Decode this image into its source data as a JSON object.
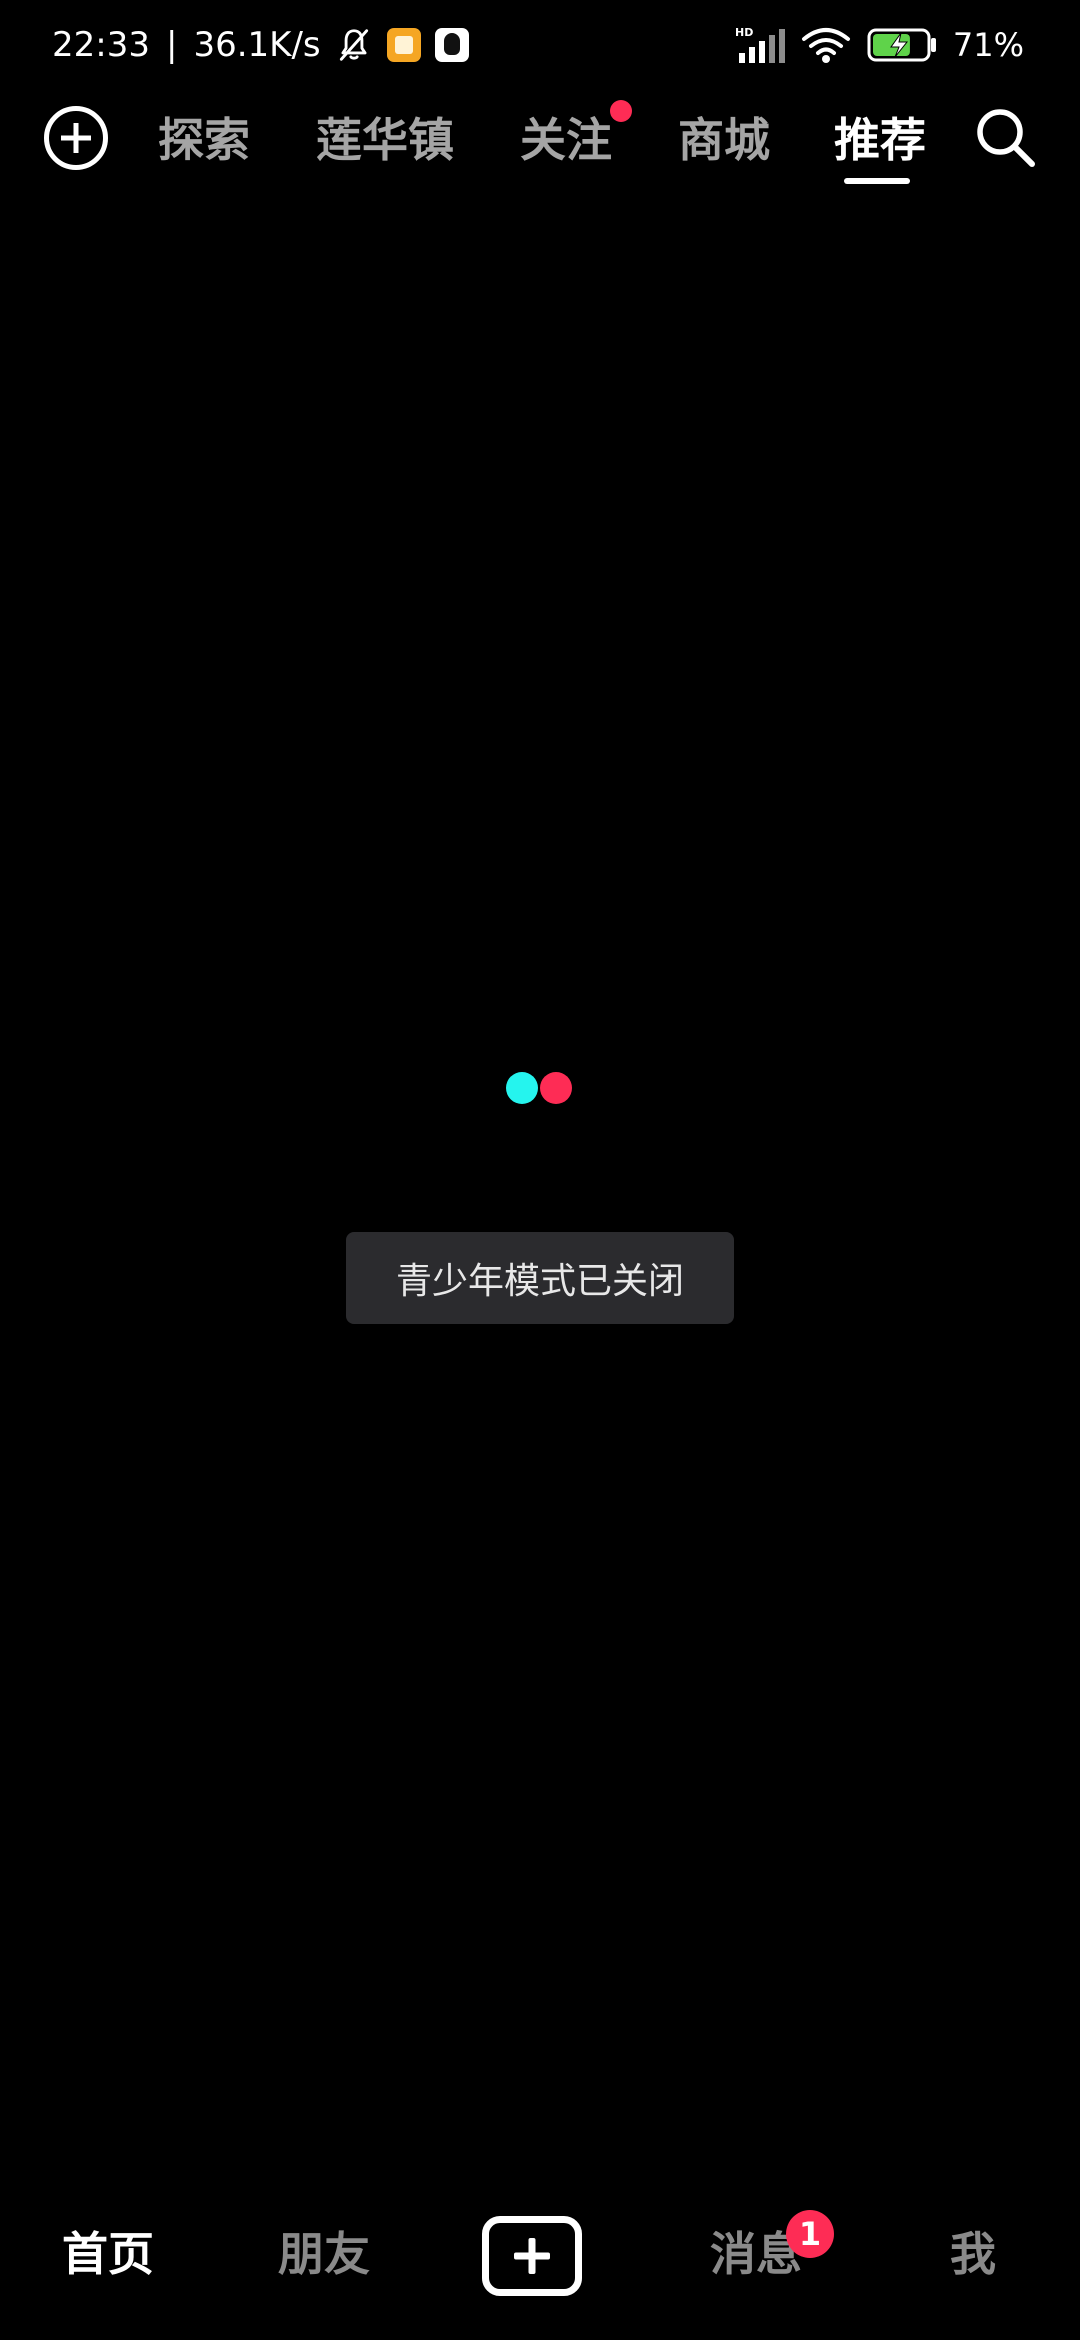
{
  "status_bar": {
    "time": "22:33",
    "separator": "|",
    "net_speed": "36.1K/s",
    "icons": [
      "bell-off-icon",
      "gallery-app-icon",
      "qq-app-icon",
      "hd-signal-icon",
      "wifi-icon",
      "battery-charging-icon"
    ],
    "hd_label": "HD",
    "battery": "71%",
    "battery_level": 0.71,
    "battery_color": "#5fd34a"
  },
  "top_nav": {
    "tabs": [
      {
        "label": "探索"
      },
      {
        "label": "莲华镇"
      },
      {
        "label": "关注",
        "has_dot": true
      },
      {
        "label": "商城"
      },
      {
        "label": "推荐",
        "active": true
      }
    ],
    "icons": [
      "plus-circle-icon",
      "search-icon"
    ]
  },
  "toast": {
    "text": "青少年模式已关闭"
  },
  "bottom_nav": {
    "items": [
      {
        "label": "首页",
        "active": true
      },
      {
        "label": "朋友"
      },
      {
        "label": "消息",
        "badge": "1"
      },
      {
        "label": "我"
      }
    ],
    "create_icon": "plus-box-icon"
  },
  "colors": {
    "background": "#000000",
    "accent_red": "#fe2c55",
    "accent_cyan": "#25f4ee",
    "inactive_text": "#a5a5a5"
  }
}
